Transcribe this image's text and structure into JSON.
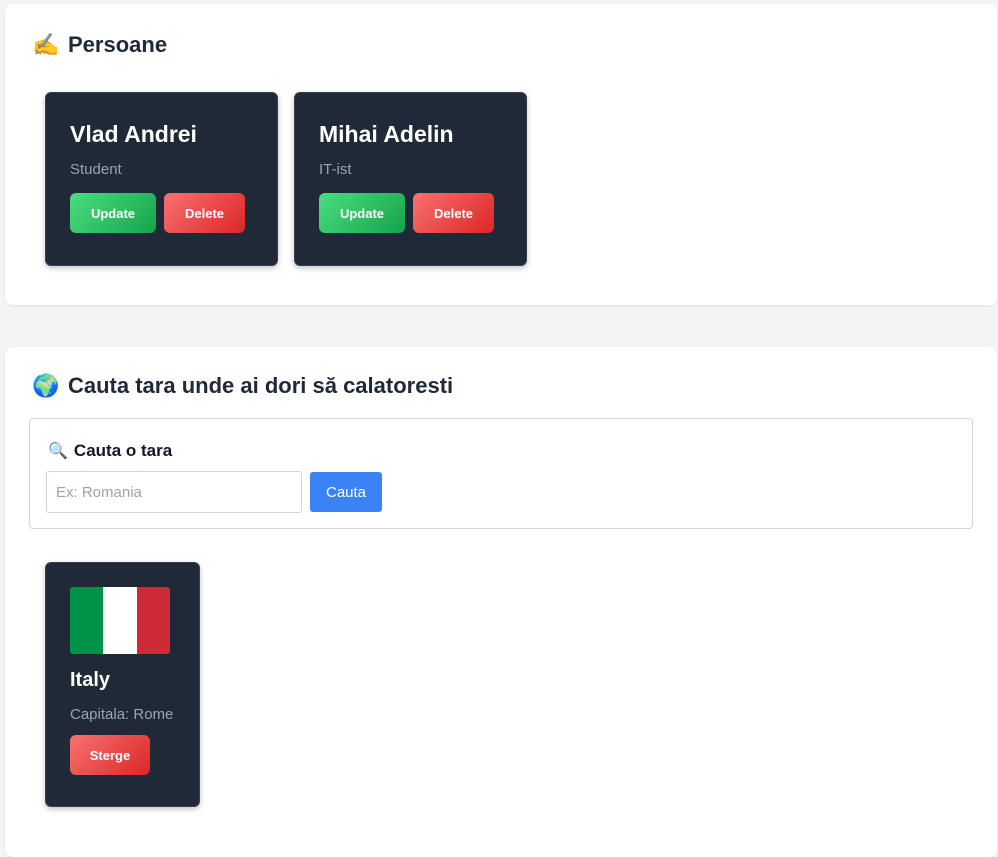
{
  "persons_section": {
    "icon": "writing-hand-icon",
    "emoji": "✍️",
    "title": "Persoane",
    "people": [
      {
        "name": "Vlad Andrei",
        "role": "Student",
        "update_label": "Update",
        "delete_label": "Delete"
      },
      {
        "name": "Mihai Adelin",
        "role": "IT-ist",
        "update_label": "Update",
        "delete_label": "Delete"
      }
    ]
  },
  "countries_section": {
    "icon": "globe-icon",
    "emoji": "🌍",
    "title": "Cauta tara unde ai dori să calatoresti",
    "search": {
      "icon": "magnifier-icon",
      "emoji": "🔍",
      "label": "Cauta o tara",
      "placeholder": "Ex: Romania",
      "value": "",
      "button_label": "Cauta"
    },
    "countries": [
      {
        "name": "Italy",
        "capital_label": "Capitala: Rome",
        "flag_colors": [
          "#009246",
          "#ffffff",
          "#ce2b37"
        ],
        "delete_label": "Sterge"
      }
    ]
  },
  "colors": {
    "card_bg": "#1f2937",
    "update_green": "#22c55e",
    "delete_red": "#ef4444",
    "search_blue": "#3b82f6"
  }
}
